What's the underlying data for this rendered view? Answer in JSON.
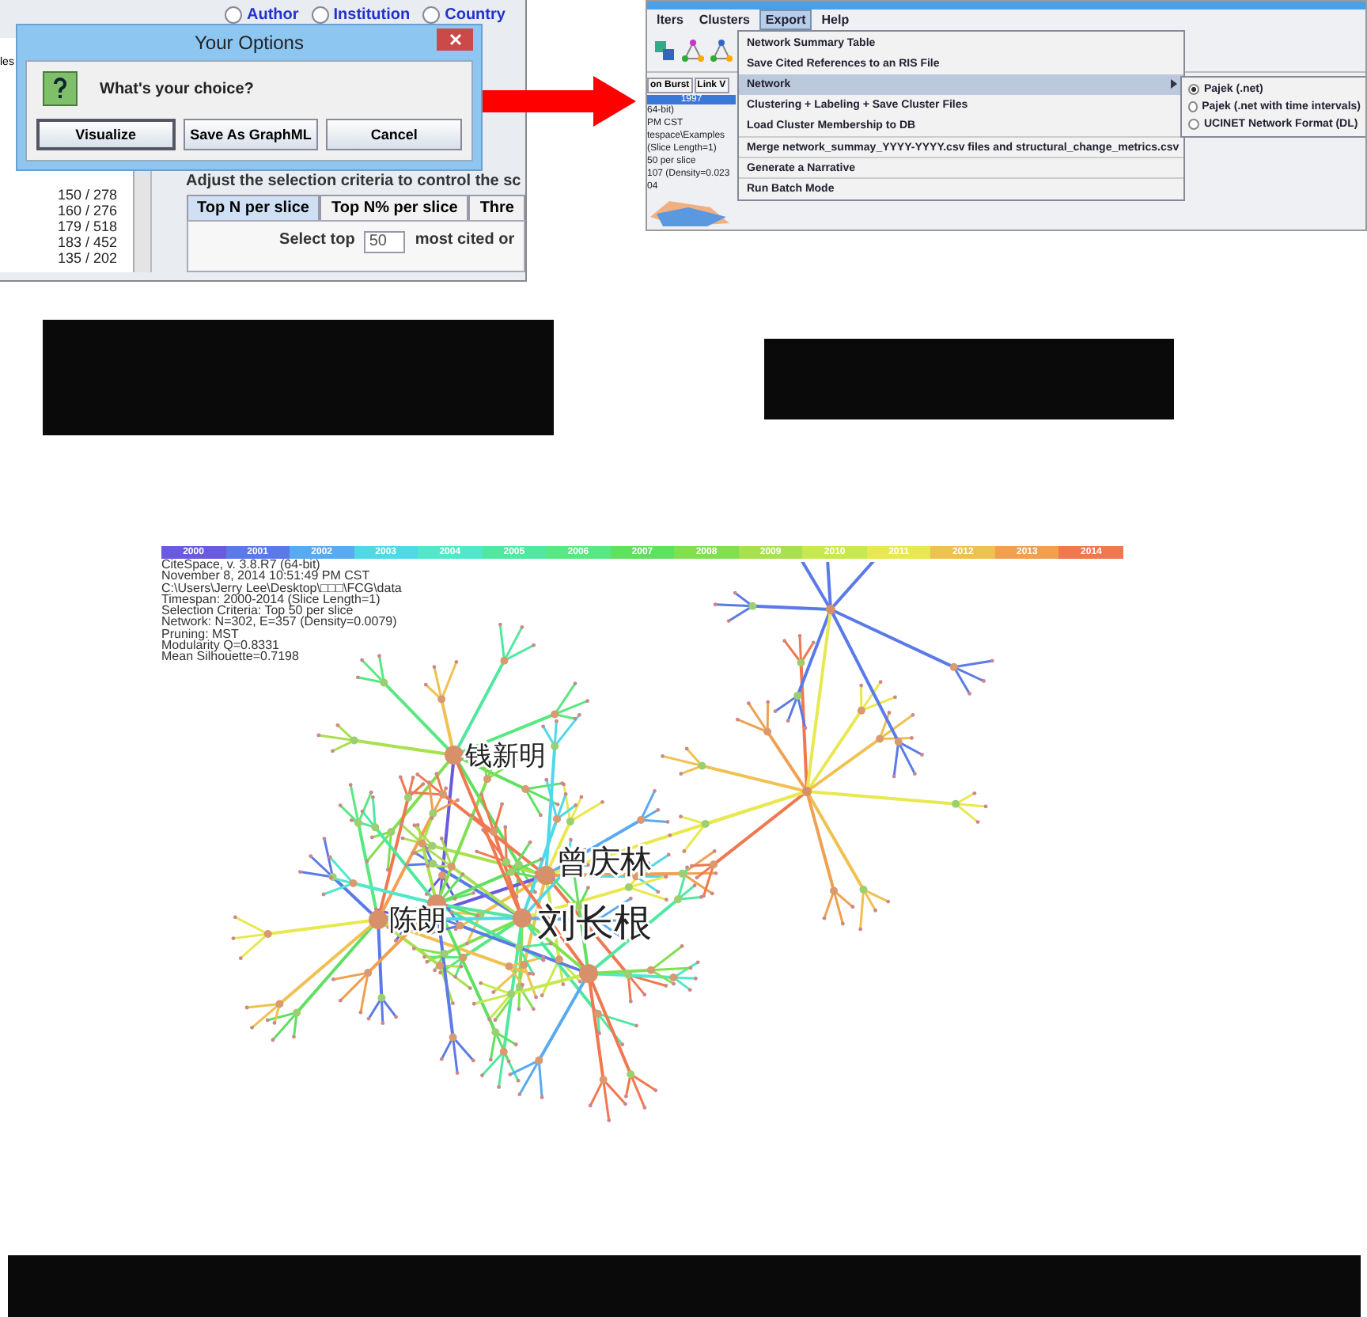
{
  "left_screenshot": {
    "radio_options": [
      "Author",
      "Institution",
      "Country"
    ],
    "partial_label": "les",
    "counts": [
      "150 / 278",
      "160 / 276",
      "179 / 518",
      "183 / 452",
      "135 / 202"
    ],
    "selection_hint": "Adjust the selection criteria to control the sc",
    "tabs": [
      {
        "label": "Top N per slice",
        "selected": true
      },
      {
        "label": "Top N% per slice",
        "selected": false
      },
      {
        "label": "Thre",
        "selected": false
      }
    ],
    "select_prefix": "Select top",
    "select_value": "50",
    "select_suffix": "most cited or",
    "dialog": {
      "title": "Your Options",
      "message": "What's your choice?",
      "buttons": [
        {
          "label": "Visualize",
          "focused": true
        },
        {
          "label": "Save As GraphML",
          "focused": false
        },
        {
          "label": "Cancel",
          "focused": false
        }
      ]
    }
  },
  "right_screenshot": {
    "menus": [
      {
        "label": "lters",
        "selected": false
      },
      {
        "label": "Clusters",
        "selected": false
      },
      {
        "label": "Export",
        "selected": true
      },
      {
        "label": "Help",
        "selected": false
      }
    ],
    "side_buttons": [
      "on Burst",
      "Link V"
    ],
    "year": "1997",
    "info_lines": [
      "64-bit)",
      "PM CST",
      "tespace\\Examples",
      "(Slice Length=1)",
      "50 per slice",
      "107 (Density=0.023"
    ],
    "node_label": "04",
    "export_menu": [
      {
        "label": "Network Summary Table",
        "kind": "item",
        "highlighted": false
      },
      {
        "label": "Save Cited References to an RIS File",
        "kind": "item",
        "highlighted": false
      },
      {
        "label": "Network",
        "kind": "submenu",
        "highlighted": true
      },
      {
        "label": "Clustering + Labeling + Save Cluster Files",
        "kind": "item",
        "highlighted": false
      },
      {
        "label": "Load Cluster Membership to DB",
        "kind": "item",
        "highlighted": false
      },
      {
        "label": "Merge network_summay_YYYY-YYYY.csv files and structural_change_metrics.csv",
        "kind": "item",
        "highlighted": false
      },
      {
        "label": "Generate a Narrative",
        "kind": "item",
        "highlighted": false
      },
      {
        "label": "Run Batch Mode",
        "kind": "item",
        "highlighted": false
      }
    ],
    "submenu": [
      {
        "label": "Pajek (.net)",
        "selected": true
      },
      {
        "label": "Pajek (.net with time intervals)",
        "selected": false
      },
      {
        "label": "UCINET Network Format (DL)",
        "selected": false
      }
    ]
  },
  "network": {
    "legend": [
      {
        "year": "2000",
        "color": "#6a5ae0"
      },
      {
        "year": "2001",
        "color": "#5a7ae8"
      },
      {
        "year": "2002",
        "color": "#5aaaf0"
      },
      {
        "year": "2003",
        "color": "#50d8e8"
      },
      {
        "year": "2004",
        "color": "#50e8c8"
      },
      {
        "year": "2005",
        "color": "#50e8a0"
      },
      {
        "year": "2006",
        "color": "#58e880"
      },
      {
        "year": "2007",
        "color": "#60e060"
      },
      {
        "year": "2008",
        "color": "#80e050"
      },
      {
        "year": "2009",
        "color": "#a8e050"
      },
      {
        "year": "2010",
        "color": "#c8e850"
      },
      {
        "year": "2011",
        "color": "#e8e850"
      },
      {
        "year": "2012",
        "color": "#f0c050"
      },
      {
        "year": "2013",
        "color": "#f0a050"
      },
      {
        "year": "2014",
        "color": "#f07850"
      }
    ],
    "info": [
      "CiteSpace, v. 3.8.R7 (64-bit)",
      "November 8, 2014 10:51:49 PM CST",
      "C:\\Users\\Jerry Lee\\Desktop\\□□□\\FCG\\data",
      "Timespan: 2000-2014 (Slice Length=1)",
      "Selection Criteria: Top 50 per slice",
      "Network: N=302, E=357 (Density=0.0079)",
      "Pruning: MST",
      "Modularity Q=0.8331",
      "Mean Silhouette=0.7198"
    ],
    "labels": [
      "钱新明",
      "曾庆林",
      "刘长根",
      "陈朗"
    ]
  }
}
